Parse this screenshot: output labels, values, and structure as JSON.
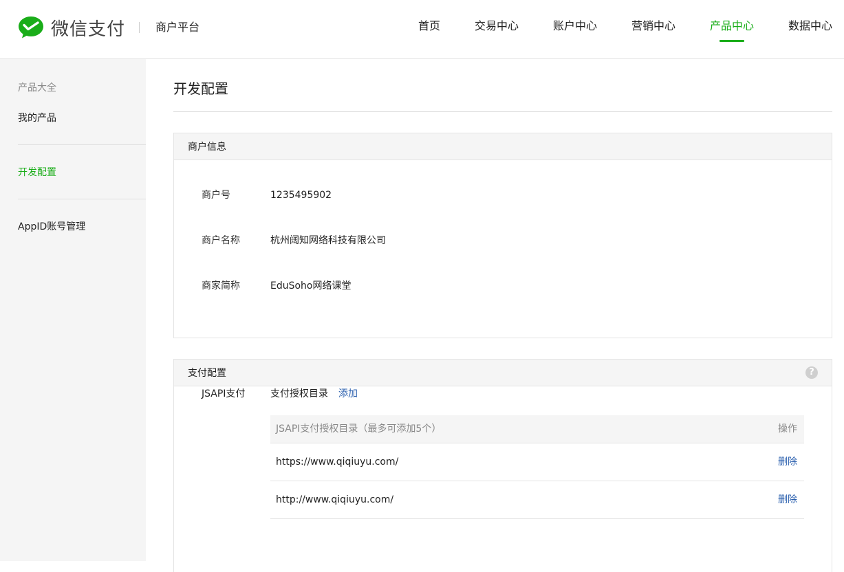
{
  "brand": {
    "name": "微信支付",
    "platform": "商户平台",
    "accent_color": "#1aad19"
  },
  "nav": {
    "items": [
      {
        "label": "首页"
      },
      {
        "label": "交易中心"
      },
      {
        "label": "账户中心"
      },
      {
        "label": "营销中心"
      },
      {
        "label": "产品中心"
      },
      {
        "label": "数据中心"
      }
    ],
    "active": "产品中心"
  },
  "sidebar": {
    "category": "产品大全",
    "items": [
      {
        "label": "我的产品"
      },
      {
        "label": "开发配置"
      },
      {
        "label": "AppID账号管理"
      }
    ],
    "active": "开发配置"
  },
  "main": {
    "title": "开发配置",
    "merchant_panel": {
      "title": "商户信息",
      "rows": [
        {
          "label": "商户号",
          "value": "1235495902"
        },
        {
          "label": "商户名称",
          "value": "杭州阔知网络科技有限公司"
        },
        {
          "label": "商家简称",
          "value": "EduSoho网络课堂"
        }
      ]
    },
    "pay_panel": {
      "title": "支付配置",
      "help_icon": "question-circle-icon",
      "jsapi_label": "JSAPI支付",
      "dir_label": "支付授权目录",
      "add_label": "添加",
      "table": {
        "headers": [
          "JSAPI支付授权目录（最多可添加5个）",
          "操作"
        ],
        "rows": [
          {
            "url": "https://www.qiqiuyu.com/",
            "action": "删除"
          },
          {
            "url": "http://www.qiqiuyu.com/",
            "action": "删除"
          }
        ]
      }
    }
  }
}
